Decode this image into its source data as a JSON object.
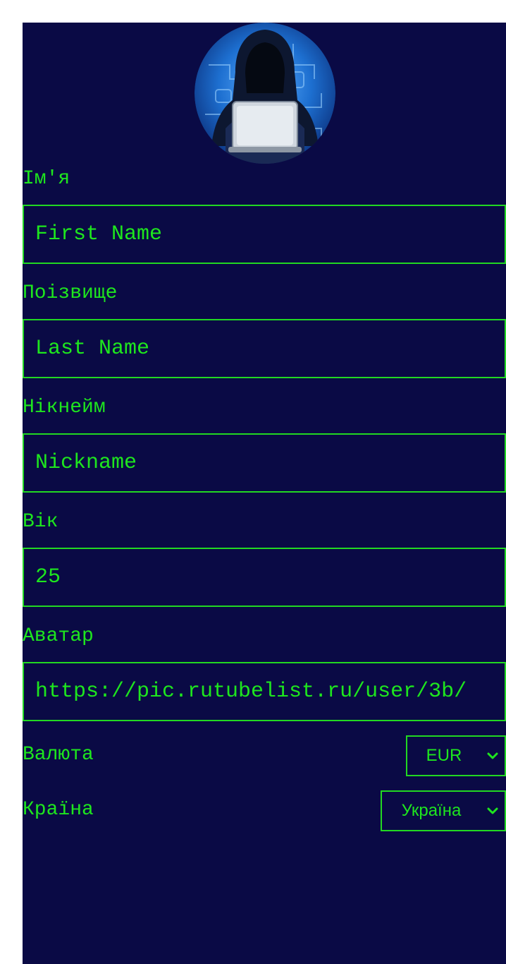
{
  "profile": {
    "avatar_alt": "hooded-hacker-avatar"
  },
  "form": {
    "first_name": {
      "label": "Ім'я",
      "placeholder": "First Name",
      "value": ""
    },
    "last_name": {
      "label": "Поізвище",
      "placeholder": "Last Name",
      "value": ""
    },
    "nickname": {
      "label": "Нікнейм",
      "placeholder": "Nickname",
      "value": ""
    },
    "age": {
      "label": "Вік",
      "placeholder": "",
      "value": "25"
    },
    "avatar": {
      "label": "Аватар",
      "placeholder": "",
      "value": "https://pic.rutubelist.ru/user/3b/"
    },
    "currency": {
      "label": "Валюта",
      "selected": "EUR"
    },
    "country": {
      "label": "Країна",
      "selected": "Україна"
    }
  },
  "colors": {
    "background": "#0a0a45",
    "accent": "#1ee61e",
    "border": "#22d822"
  }
}
